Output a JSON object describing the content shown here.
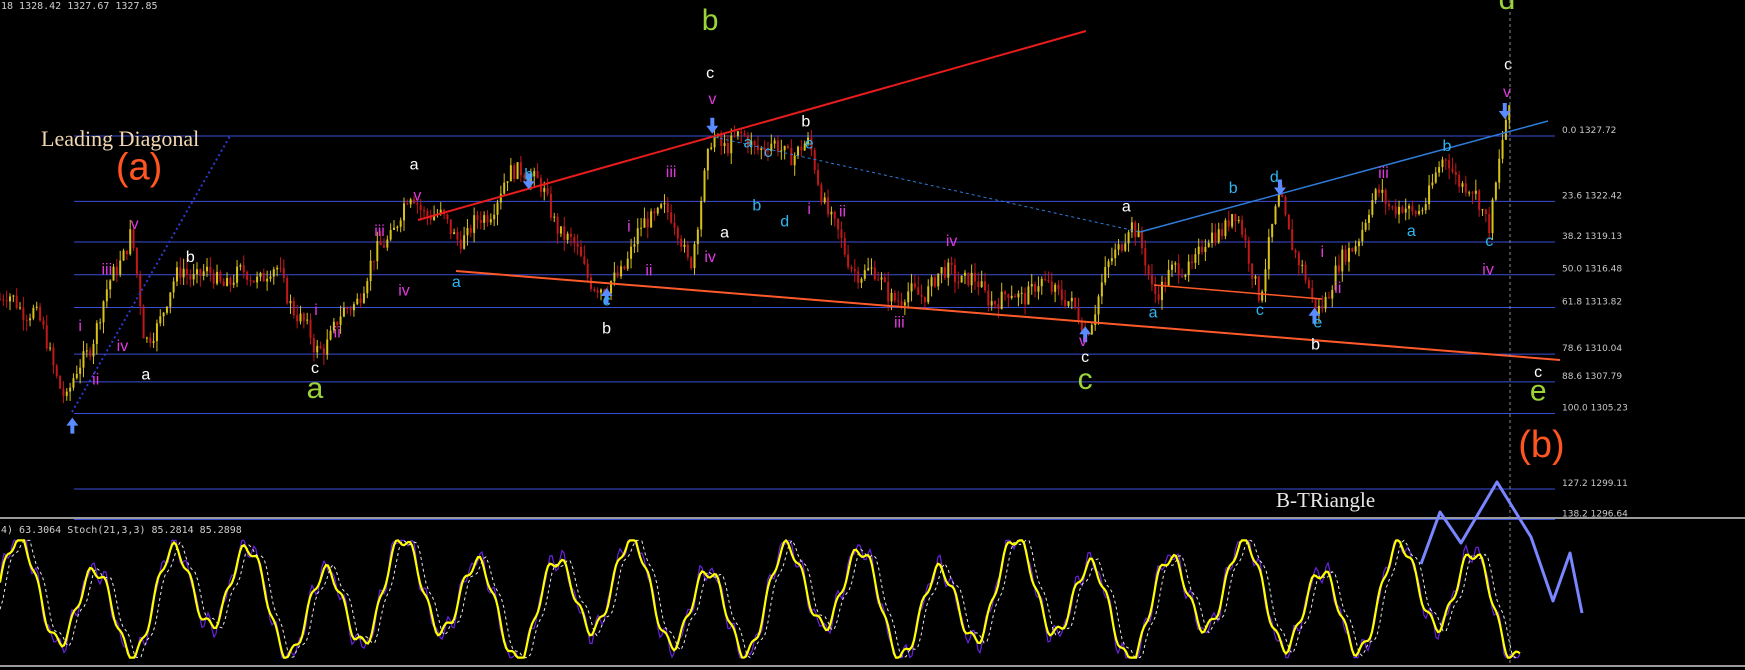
{
  "window": {
    "ohlc_header": "18 1328.42 1327.67 1327.85",
    "indicator_header": "4) 63.3064  Stoch(21,3,3) 85.2814 85.2898"
  },
  "colors": {
    "background": "#000000",
    "fib_line": "#3a4fd8",
    "trendline_red": "#e81c1c",
    "trendline_orange": "#ff5a2a",
    "channel_blue": "#2f7bd8",
    "candle_up": "#d8c21a",
    "candle_down": "#c21818",
    "stoch_main": "#ffff00",
    "stoch_signal": "#e8e8e8",
    "stoch_aux": "#6a22e0",
    "projection": "#7a86ff",
    "magenta": "#e03adf",
    "cyan": "#2fb5f0",
    "white": "#ffffff",
    "green": "#9cd438",
    "orange": "#ff5522",
    "arrow_blue": "#5a8cff"
  },
  "icons": {
    "pivot_up": "arrow-up-icon",
    "pivot_down": "arrow-down-icon"
  },
  "chart_data": {
    "type": "candlestick",
    "y_axis_unit": "price",
    "ylim": [
      1294.5,
      1331.0
    ],
    "fib_levels": [
      {
        "label": "0.0 1327.72",
        "price": 1327.72
      },
      {
        "label": "23.6 1322.42",
        "price": 1322.42
      },
      {
        "label": "38.2 1319.13",
        "price": 1319.13
      },
      {
        "label": "50.0 1316.48",
        "price": 1316.48
      },
      {
        "label": "61.8 1313.82",
        "price": 1313.82
      },
      {
        "label": "78.6 1310.04",
        "price": 1310.04
      },
      {
        "label": "88.6 1307.79",
        "price": 1307.79
      },
      {
        "label": "100.0 1305.23",
        "price": 1305.23
      },
      {
        "label": "127.2 1299.11",
        "price": 1299.11
      },
      {
        "label": "138.2 1296.64",
        "price": 1296.64
      }
    ],
    "annotations": {
      "leading_diagonal": "Leading Diagonal",
      "b_triangle": "B-TRiangle"
    },
    "wave_labels": [
      {
        "text": "(a)",
        "bar": 125,
        "price": 1324.2,
        "color": "orange",
        "size": "xl"
      },
      {
        "text": "(b)",
        "bar": 1385,
        "price": 1301.7,
        "color": "orange",
        "size": "xl"
      },
      {
        "text": "b",
        "bar": 638,
        "price": 1336.3,
        "color": "green",
        "size": "lg"
      },
      {
        "text": "d",
        "bar": 1354,
        "price": 1338.0,
        "color": "green",
        "size": "lg"
      },
      {
        "text": "a",
        "bar": 283,
        "price": 1306.5,
        "color": "green",
        "size": "lg"
      },
      {
        "text": "c",
        "bar": 975,
        "price": 1307.2,
        "color": "green",
        "size": "lg"
      },
      {
        "text": "e",
        "bar": 1382,
        "price": 1306.3,
        "color": "green",
        "size": "lg"
      },
      {
        "text": "i",
        "bar": 72,
        "price": 1311.9,
        "color": "magenta",
        "size": "sm"
      },
      {
        "text": "ii",
        "bar": 86,
        "price": 1307.6,
        "color": "magenta",
        "size": "sm"
      },
      {
        "text": "iii",
        "bar": 96,
        "price": 1316.5,
        "color": "magenta",
        "size": "sm"
      },
      {
        "text": "iv",
        "bar": 110,
        "price": 1310.3,
        "color": "magenta",
        "size": "sm"
      },
      {
        "text": "v",
        "bar": 121,
        "price": 1320.2,
        "color": "magenta",
        "size": "sm"
      },
      {
        "text": "a",
        "bar": 131,
        "price": 1308.0,
        "color": "white",
        "size": "sm"
      },
      {
        "text": "b",
        "bar": 171,
        "price": 1317.5,
        "color": "white",
        "size": "sm"
      },
      {
        "text": "i",
        "bar": 284,
        "price": 1313.2,
        "color": "magenta",
        "size": "sm"
      },
      {
        "text": "ii",
        "bar": 303,
        "price": 1311.4,
        "color": "magenta",
        "size": "sm"
      },
      {
        "text": "c",
        "bar": 283,
        "price": 1308.5,
        "color": "white",
        "size": "sm"
      },
      {
        "text": "iii",
        "bar": 341,
        "price": 1319.6,
        "color": "magenta",
        "size": "sm"
      },
      {
        "text": "iv",
        "bar": 363,
        "price": 1314.8,
        "color": "magenta",
        "size": "sm"
      },
      {
        "text": "a",
        "bar": 372,
        "price": 1325.0,
        "color": "white",
        "size": "sm"
      },
      {
        "text": "v",
        "bar": 375,
        "price": 1322.5,
        "color": "magenta",
        "size": "sm"
      },
      {
        "text": "a",
        "bar": 410,
        "price": 1315.5,
        "color": "cyan",
        "size": "sm"
      },
      {
        "text": "b",
        "bar": 475,
        "price": 1324.2,
        "color": "cyan",
        "size": "sm"
      },
      {
        "text": "i",
        "bar": 565,
        "price": 1320.0,
        "color": "magenta",
        "size": "sm"
      },
      {
        "text": "ii",
        "bar": 583,
        "price": 1316.4,
        "color": "magenta",
        "size": "sm"
      },
      {
        "text": "c",
        "bar": 545,
        "price": 1314.0,
        "color": "cyan",
        "size": "sm"
      },
      {
        "text": "b",
        "bar": 545,
        "price": 1311.7,
        "color": "white",
        "size": "sm"
      },
      {
        "text": "iii",
        "bar": 603,
        "price": 1324.4,
        "color": "magenta",
        "size": "sm"
      },
      {
        "text": "iv",
        "bar": 638,
        "price": 1317.5,
        "color": "magenta",
        "size": "sm"
      },
      {
        "text": "a",
        "bar": 651,
        "price": 1319.5,
        "color": "white",
        "size": "sm"
      },
      {
        "text": "c",
        "bar": 638,
        "price": 1332.4,
        "color": "white",
        "size": "sm"
      },
      {
        "text": "v",
        "bar": 640,
        "price": 1330.3,
        "color": "magenta",
        "size": "sm"
      },
      {
        "text": "a",
        "bar": 672,
        "price": 1326.8,
        "color": "cyan",
        "size": "sm"
      },
      {
        "text": "b",
        "bar": 680,
        "price": 1321.7,
        "color": "cyan",
        "size": "sm"
      },
      {
        "text": "c",
        "bar": 690,
        "price": 1326.0,
        "color": "cyan",
        "size": "sm"
      },
      {
        "text": "d",
        "bar": 705,
        "price": 1320.4,
        "color": "cyan",
        "size": "sm"
      },
      {
        "text": "b",
        "bar": 724,
        "price": 1328.5,
        "color": "white",
        "size": "sm"
      },
      {
        "text": "e",
        "bar": 727,
        "price": 1326.7,
        "color": "cyan",
        "size": "sm"
      },
      {
        "text": "i",
        "bar": 727,
        "price": 1321.4,
        "color": "magenta",
        "size": "sm"
      },
      {
        "text": "ii",
        "bar": 757,
        "price": 1321.2,
        "color": "magenta",
        "size": "sm"
      },
      {
        "text": "iii",
        "bar": 808,
        "price": 1312.2,
        "color": "magenta",
        "size": "sm"
      },
      {
        "text": "iv",
        "bar": 855,
        "price": 1318.8,
        "color": "magenta",
        "size": "sm"
      },
      {
        "text": "v",
        "bar": 973,
        "price": 1310.7,
        "color": "magenta",
        "size": "sm"
      },
      {
        "text": "c",
        "bar": 975,
        "price": 1309.4,
        "color": "white",
        "size": "sm"
      },
      {
        "text": "a",
        "bar": 1012,
        "price": 1321.6,
        "color": "white",
        "size": "sm"
      },
      {
        "text": "a",
        "bar": 1036,
        "price": 1313.0,
        "color": "cyan",
        "size": "sm"
      },
      {
        "text": "b",
        "bar": 1108,
        "price": 1323.1,
        "color": "cyan",
        "size": "sm"
      },
      {
        "text": "c",
        "bar": 1132,
        "price": 1313.2,
        "color": "cyan",
        "size": "sm"
      },
      {
        "text": "d",
        "bar": 1145,
        "price": 1324.0,
        "color": "cyan",
        "size": "sm"
      },
      {
        "text": "i",
        "bar": 1188,
        "price": 1317.9,
        "color": "magenta",
        "size": "sm"
      },
      {
        "text": "ii",
        "bar": 1202,
        "price": 1315.0,
        "color": "magenta",
        "size": "sm"
      },
      {
        "text": "e",
        "bar": 1184,
        "price": 1312.2,
        "color": "cyan",
        "size": "sm"
      },
      {
        "text": "b",
        "bar": 1182,
        "price": 1310.4,
        "color": "white",
        "size": "sm"
      },
      {
        "text": "iii",
        "bar": 1243,
        "price": 1324.3,
        "color": "magenta",
        "size": "sm"
      },
      {
        "text": "a",
        "bar": 1268,
        "price": 1319.6,
        "color": "cyan",
        "size": "sm"
      },
      {
        "text": "b",
        "bar": 1300,
        "price": 1326.5,
        "color": "cyan",
        "size": "sm"
      },
      {
        "text": "c",
        "bar": 1338,
        "price": 1318.8,
        "color": "cyan",
        "size": "sm"
      },
      {
        "text": "iv",
        "bar": 1337,
        "price": 1316.5,
        "color": "magenta",
        "size": "sm"
      },
      {
        "text": "c",
        "bar": 1355,
        "price": 1333.1,
        "color": "white",
        "size": "sm"
      },
      {
        "text": "v",
        "bar": 1354,
        "price": 1330.9,
        "color": "magenta",
        "size": "sm"
      },
      {
        "text": "c",
        "bar": 1382,
        "price": 1308.2,
        "color": "white",
        "size": "sm"
      }
    ],
    "pivots_up": [
      {
        "bar": 65,
        "price": 1304.9
      },
      {
        "bar": 545,
        "price": 1315.4
      },
      {
        "bar": 975,
        "price": 1312.3
      },
      {
        "bar": 1181,
        "price": 1313.8
      }
    ],
    "pivots_down": [
      {
        "bar": 640,
        "price": 1327.9
      },
      {
        "bar": 475,
        "price": 1323.4
      },
      {
        "bar": 1150,
        "price": 1322.9
      },
      {
        "bar": 1352,
        "price": 1329.1
      }
    ]
  }
}
